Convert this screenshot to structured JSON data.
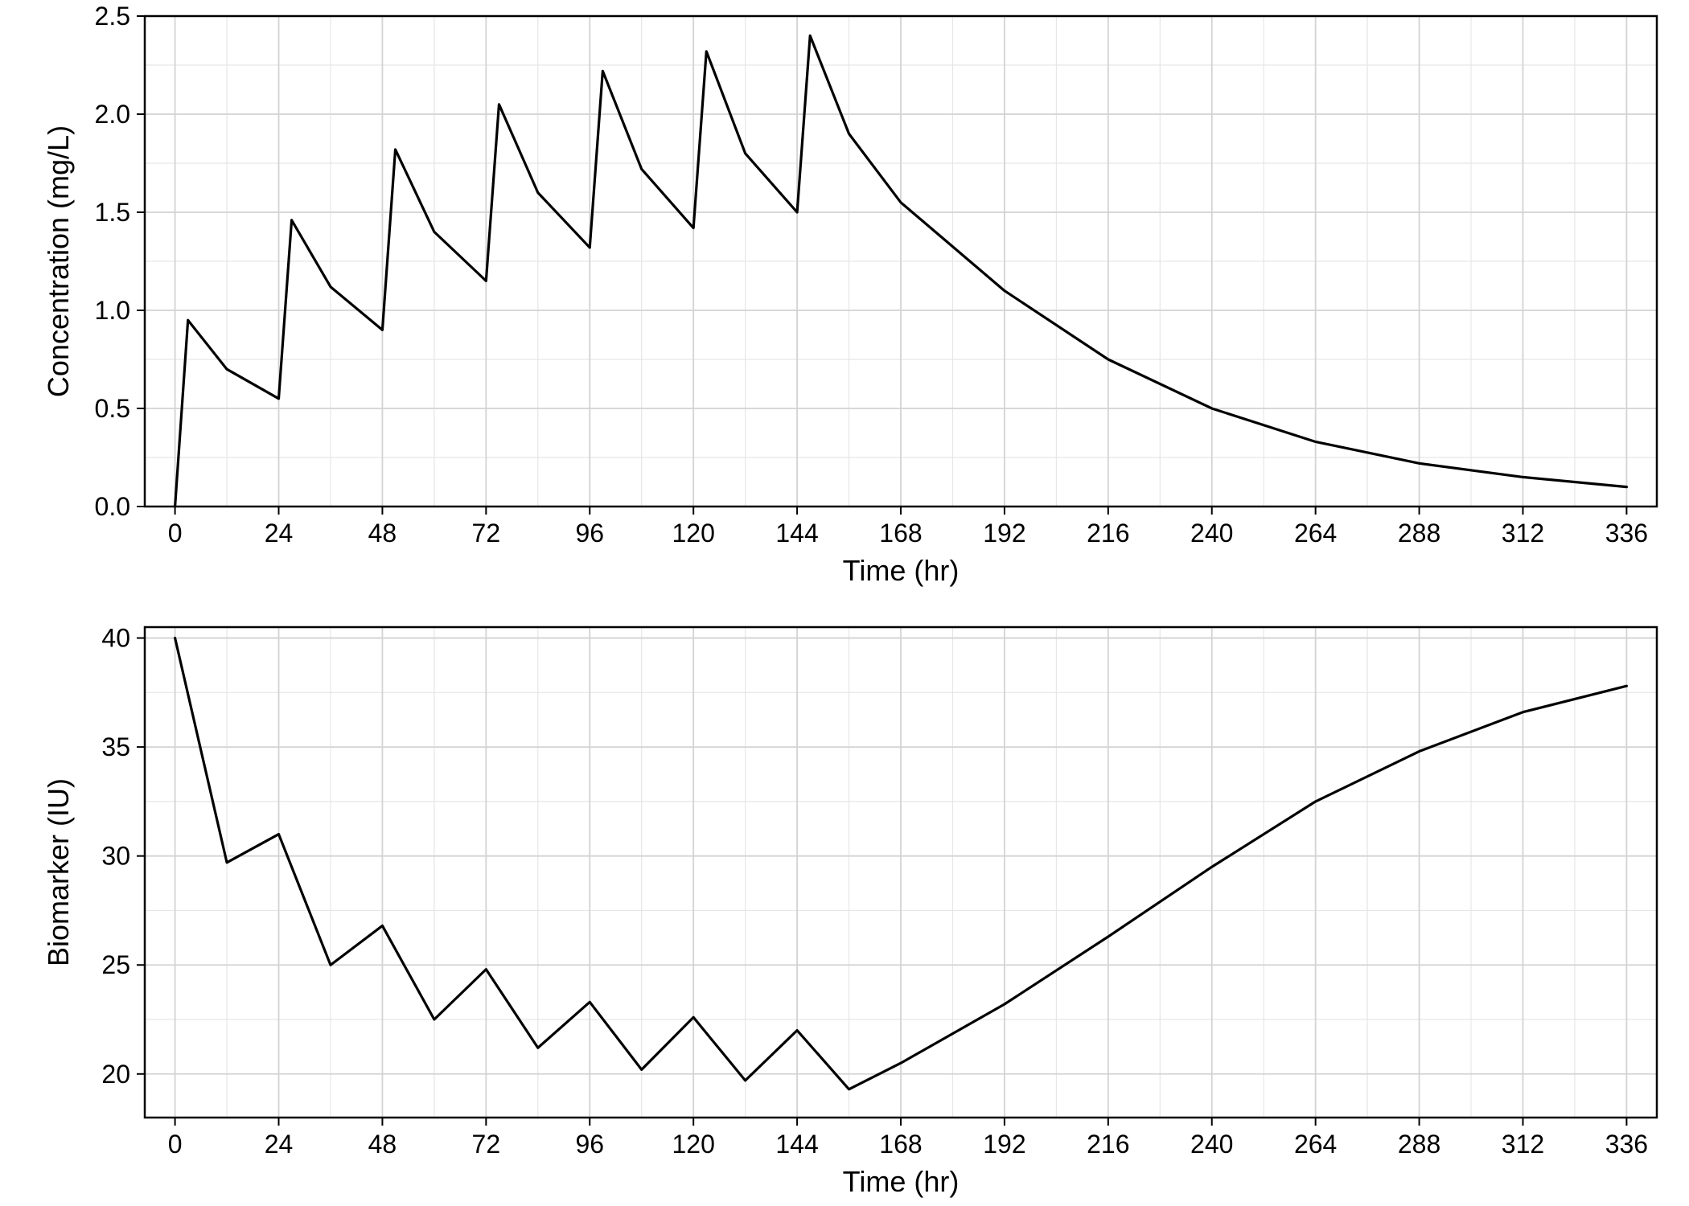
{
  "chart_data": [
    {
      "type": "line",
      "title": "",
      "xlabel": "Time (hr)",
      "ylabel": "Concentration (mg/L)",
      "xlim": [
        0,
        336
      ],
      "ylim": [
        0,
        2.5
      ],
      "xticks": [
        0,
        24,
        48,
        72,
        96,
        120,
        144,
        168,
        192,
        216,
        240,
        264,
        288,
        312,
        336
      ],
      "yticks": [
        0.0,
        0.5,
        1.0,
        1.5,
        2.0,
        2.5
      ],
      "series": [
        {
          "name": "Concentration",
          "x": [
            0,
            3,
            12,
            24,
            27,
            36,
            48,
            51,
            60,
            72,
            75,
            84,
            96,
            99,
            108,
            120,
            123,
            132,
            144,
            147,
            156,
            168,
            192,
            216,
            240,
            264,
            288,
            312,
            336
          ],
          "y": [
            0.0,
            0.95,
            0.7,
            0.55,
            1.46,
            1.12,
            0.9,
            1.82,
            1.4,
            1.15,
            2.05,
            1.6,
            1.32,
            2.22,
            1.72,
            1.42,
            2.32,
            1.8,
            1.5,
            2.4,
            1.9,
            1.55,
            1.1,
            0.75,
            0.5,
            0.33,
            0.22,
            0.15,
            0.1
          ]
        }
      ]
    },
    {
      "type": "line",
      "title": "",
      "xlabel": "Time (hr)",
      "ylabel": "Biomarker (IU)",
      "xlim": [
        0,
        336
      ],
      "ylim": [
        18,
        40.5
      ],
      "xticks": [
        0,
        24,
        48,
        72,
        96,
        120,
        144,
        168,
        192,
        216,
        240,
        264,
        288,
        312,
        336
      ],
      "yticks": [
        20,
        25,
        30,
        35,
        40
      ],
      "series": [
        {
          "name": "Biomarker",
          "x": [
            0,
            12,
            24,
            36,
            48,
            60,
            72,
            84,
            96,
            108,
            120,
            132,
            144,
            156,
            168,
            192,
            216,
            240,
            264,
            288,
            312,
            336
          ],
          "y": [
            40.0,
            29.7,
            31.0,
            25.0,
            26.8,
            22.5,
            24.8,
            21.2,
            23.3,
            20.2,
            22.6,
            19.7,
            22.0,
            19.3,
            20.5,
            23.2,
            26.3,
            29.5,
            32.5,
            34.8,
            36.6,
            37.8
          ]
        }
      ]
    }
  ]
}
